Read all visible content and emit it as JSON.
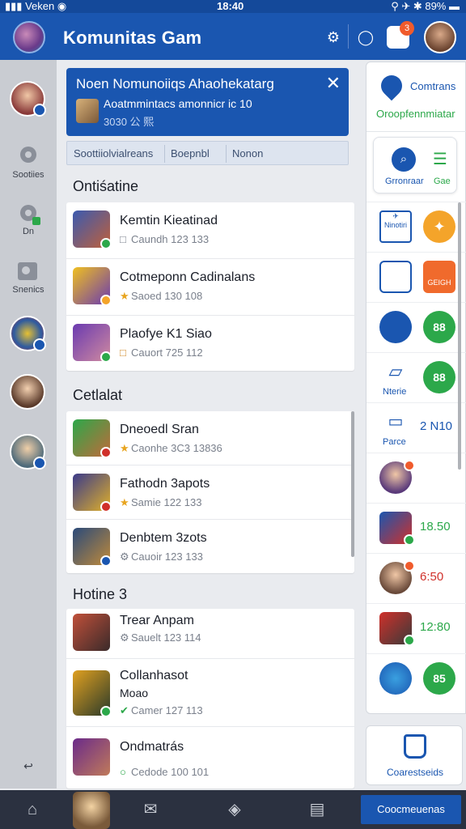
{
  "status_bar": {
    "carrier": "Veken",
    "time": "18:40",
    "battery": "89%"
  },
  "header": {
    "title": "Komunitas Gam"
  },
  "rail": {
    "items": [
      {
        "label": "Sootiies"
      },
      {
        "label": "Dn"
      },
      {
        "label": "Snenics"
      }
    ],
    "bottom_icon": "↩"
  },
  "banner": {
    "title": "Noen Nomunoiiqs Ahaohekatarg",
    "subtitle": "Aoatmmintacs amonnicr ic 10",
    "meta": "3030 公 熙"
  },
  "tabs": [
    "Soottiiolvialreans",
    "Boepnbl",
    "Nonon"
  ],
  "sections": [
    {
      "title": "Ontiśatine",
      "items": [
        {
          "title": "Kemtin Kieatinad",
          "meta": "Caundh 123 133",
          "meta_icon": "□"
        },
        {
          "title": "Cotmeponn Cadinalans",
          "meta": "Saoed 130 108",
          "meta_icon": "★"
        },
        {
          "title": "Plaofye K1 Siao",
          "meta": "Cauort 725 112",
          "meta_icon": "□"
        }
      ]
    },
    {
      "title": "Cetlalat",
      "items": [
        {
          "title": "Dneoedl Sran",
          "meta": "Caonhe 3C3 13836",
          "meta_icon": "★"
        },
        {
          "title": "Fathodn 3apots",
          "meta": "Samie 122 133",
          "meta_icon": "★"
        },
        {
          "title": "Denbtem 3zots",
          "meta": "Cauoir 123 133",
          "meta_icon": "⚙"
        }
      ]
    },
    {
      "title": "Hotine 3",
      "items": [
        {
          "title": "Trear Anpam",
          "meta": "Sauelt 123 114",
          "meta_icon": "⚙"
        },
        {
          "title": "Collanhasot",
          "title2": "Moao",
          "meta": "Camer 127 113",
          "meta_icon": "✔"
        },
        {
          "title": "Ondmatrás",
          "meta": "Cedode 100 101",
          "meta_icon": "○"
        }
      ]
    }
  ],
  "right_panel": {
    "title": "Comtrans",
    "subtitle": "Oroopfennmiatar",
    "box_labels": [
      "Grronraar",
      "Gae"
    ],
    "rows": [
      {
        "left_label": "Ninotiri",
        "right_value": ""
      },
      {
        "left_label": "",
        "right_value": "GEIGH"
      },
      {
        "left_label": "",
        "right_value": "88"
      },
      {
        "left_label": "Nterie",
        "right_value": "88"
      },
      {
        "left_label": "Parce",
        "right_value": "2 N10"
      },
      {
        "left_label": "",
        "right_value": ""
      },
      {
        "left_label": "",
        "right_value": "18.50"
      },
      {
        "left_label": "",
        "right_value": "6:50"
      },
      {
        "left_label": "",
        "right_value": "12:80"
      },
      {
        "left_label": "",
        "right_value": "85"
      }
    ],
    "bottom_label": "Coarestseids"
  },
  "bottom_nav": {
    "active_label": "Coocmeuenas"
  },
  "colors": {
    "brand": "#1a56b0",
    "accent_green": "#2ca84a",
    "accent_orange": "#f4a42a"
  }
}
